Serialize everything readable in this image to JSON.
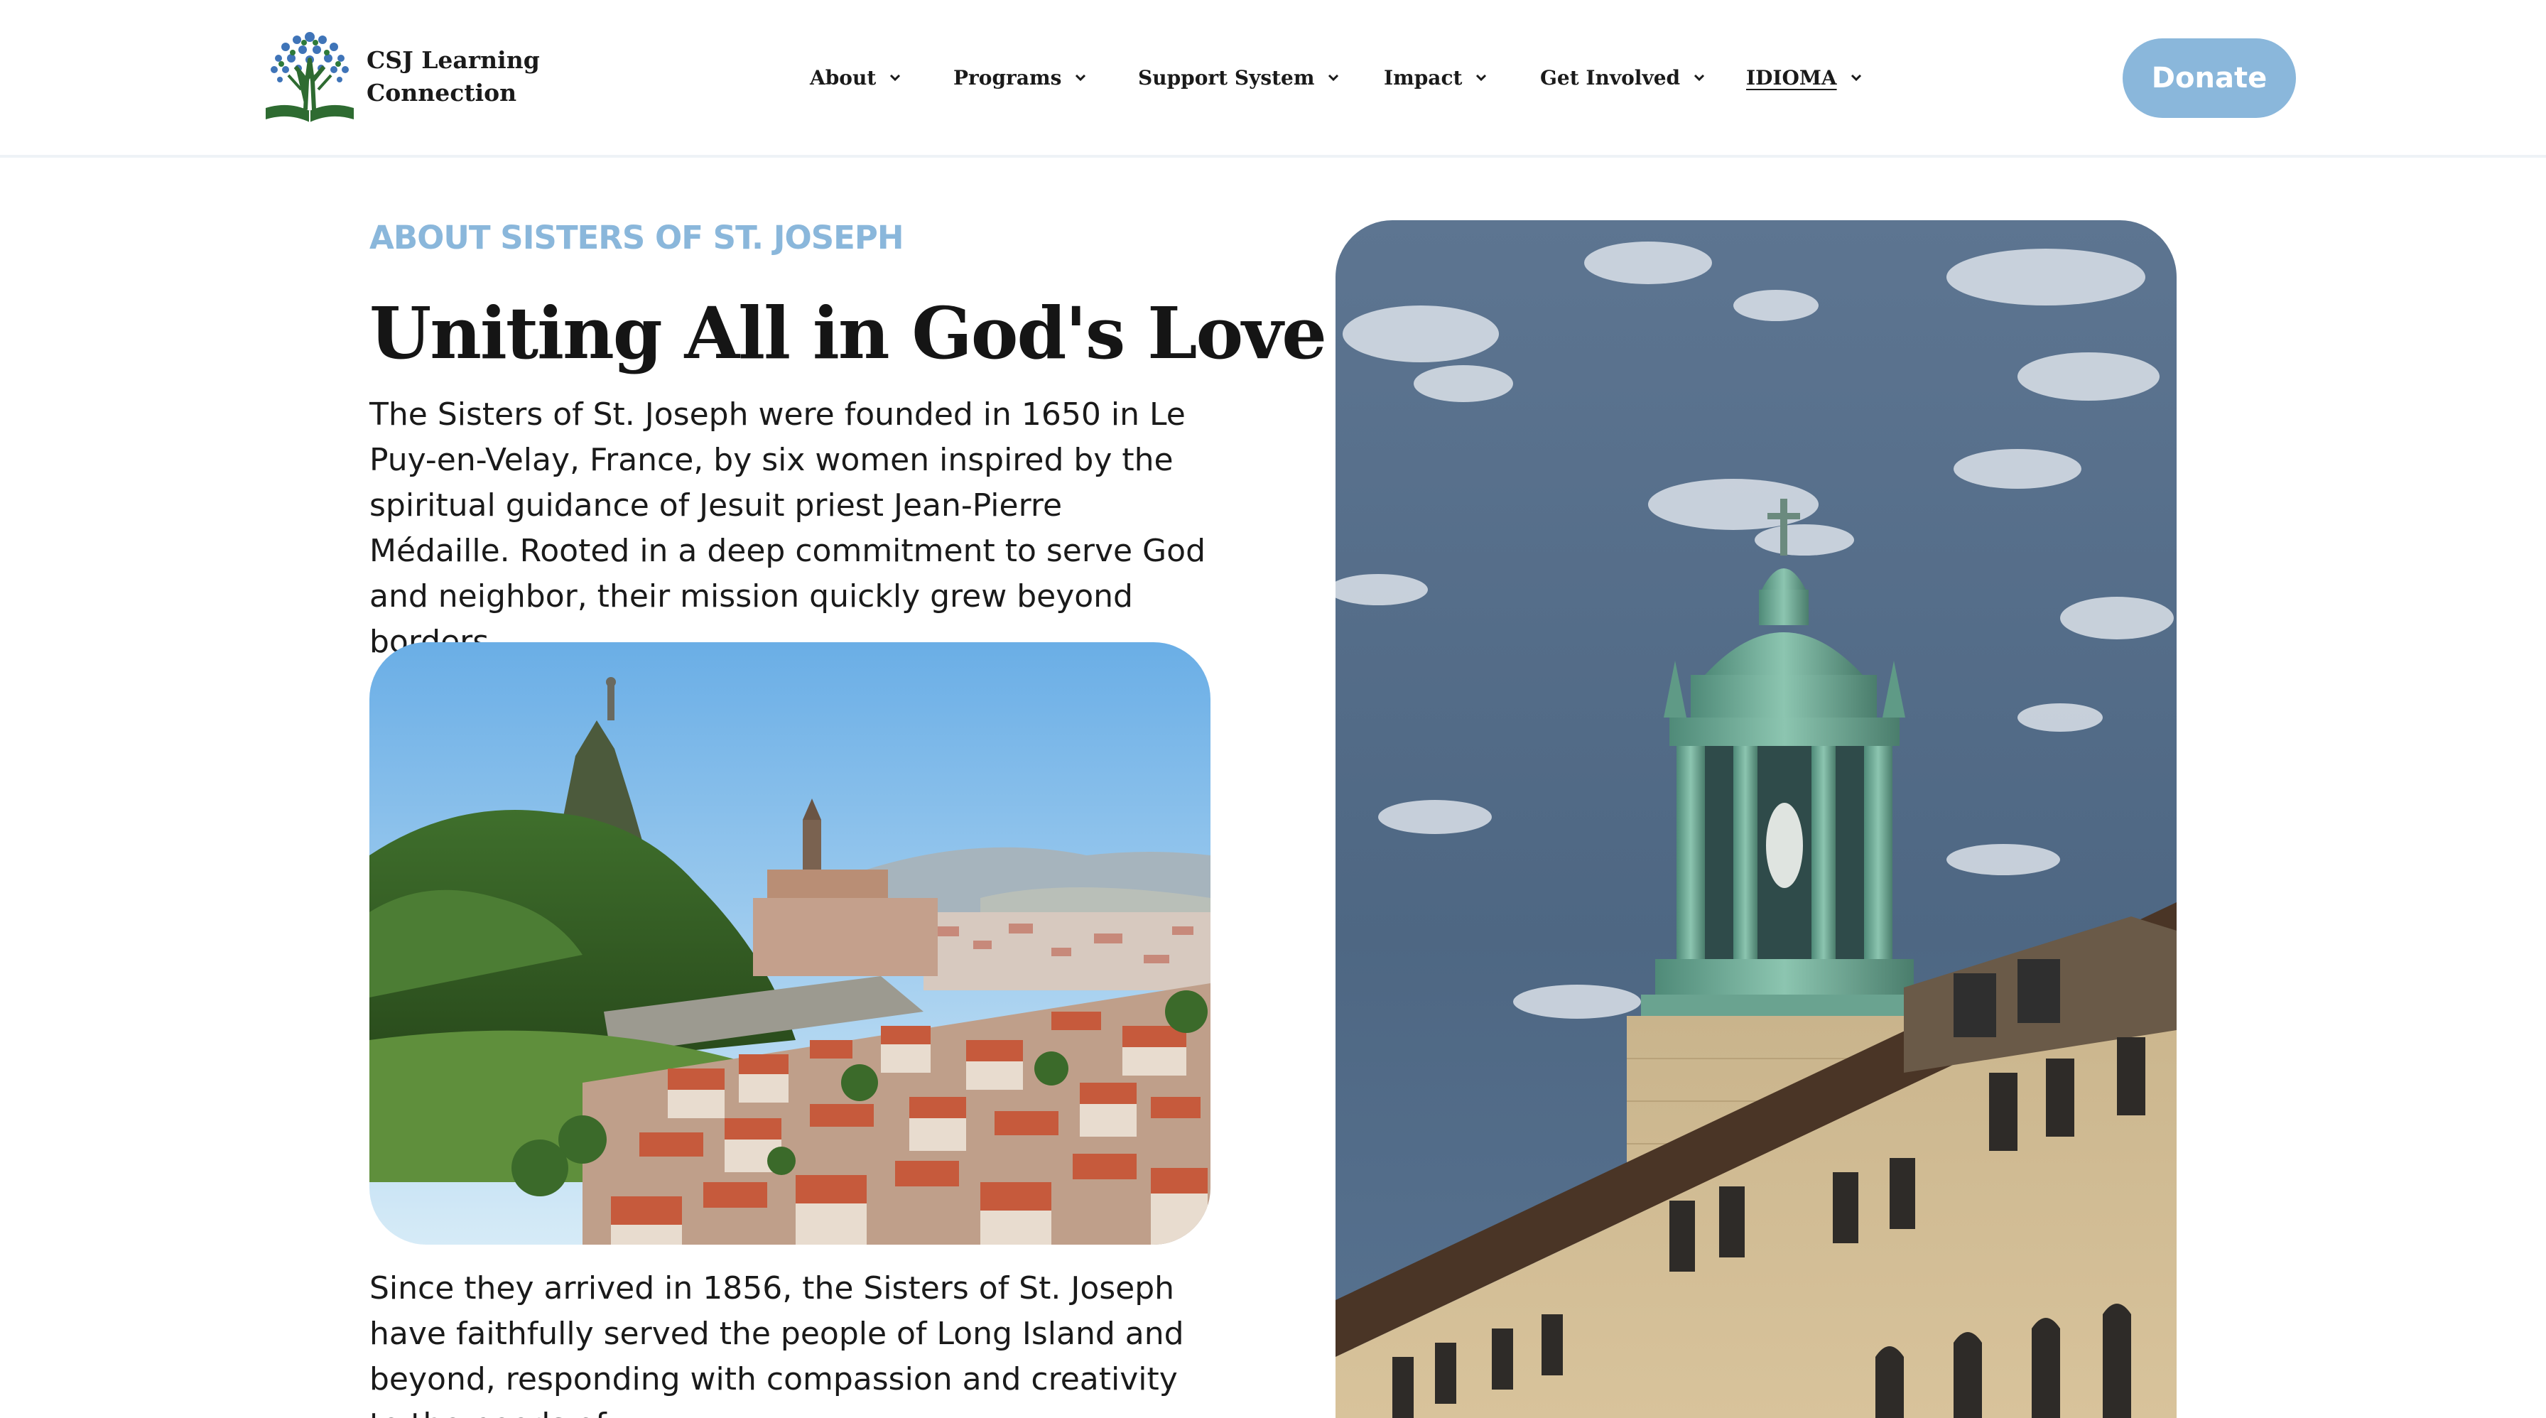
{
  "header": {
    "logo": {
      "icon": "tree-book-icon",
      "line1": "CSJ Learning",
      "line2": "Connection"
    },
    "nav": [
      {
        "label": "About",
        "icon": "chevron-down-icon"
      },
      {
        "label": "Programs",
        "icon": "chevron-down-icon"
      },
      {
        "label": "Support System",
        "icon": "chevron-down-icon"
      },
      {
        "label": "Impact",
        "icon": "chevron-down-icon"
      },
      {
        "label": "Get Involved",
        "icon": "chevron-down-icon"
      },
      {
        "label": "IDIOMA",
        "icon": "chevron-down-icon"
      }
    ],
    "donate_label": "Donate"
  },
  "content": {
    "eyebrow": "ABOUT SISTERS OF ST. JOSEPH",
    "title": "Uniting All in God's Love",
    "paragraph1": "The Sisters of St. Joseph were founded in 1650 in Le Puy-en-Velay, France, by six women inspired by the spiritual guidance of Jesuit priest Jean-Pierre Médaille. Rooted in a deep commitment to serve God and neighbor, their mission quickly grew beyond borders.",
    "paragraph2": "Since they arrived in 1856, the Sisters of St. Joseph have faithfully served the people of Long Island and beyond, responding with compassion and creativity to the needs of"
  },
  "colors": {
    "accent": "#8ab7db",
    "text": "#1a1a1a",
    "header_border": "#eef2f6"
  }
}
